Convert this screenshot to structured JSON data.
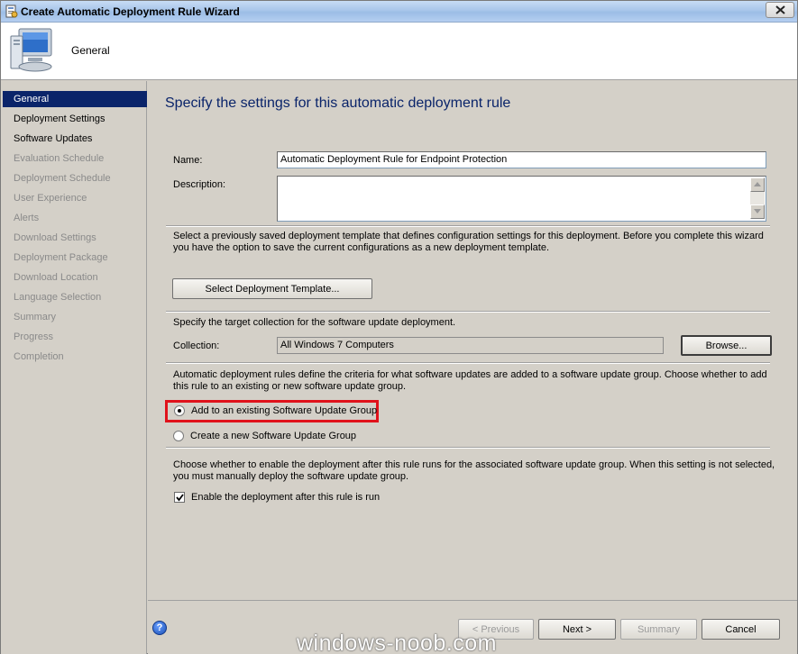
{
  "window": {
    "title": "Create Automatic Deployment Rule Wizard",
    "header_title": "General"
  },
  "sidebar": {
    "items": [
      {
        "label": "General",
        "state": "active"
      },
      {
        "label": "Deployment Settings",
        "state": "done"
      },
      {
        "label": "Software Updates",
        "state": "done"
      },
      {
        "label": "Evaluation Schedule",
        "state": "pending"
      },
      {
        "label": "Deployment Schedule",
        "state": "pending"
      },
      {
        "label": "User Experience",
        "state": "pending"
      },
      {
        "label": "Alerts",
        "state": "pending"
      },
      {
        "label": "Download Settings",
        "state": "pending"
      },
      {
        "label": "Deployment Package",
        "state": "pending"
      },
      {
        "label": "Download Location",
        "state": "pending"
      },
      {
        "label": "Language Selection",
        "state": "pending"
      },
      {
        "label": "Summary",
        "state": "pending"
      },
      {
        "label": "Progress",
        "state": "pending"
      },
      {
        "label": "Completion",
        "state": "pending"
      }
    ]
  },
  "main": {
    "heading": "Specify the settings for this automatic deployment rule",
    "name_label": "Name:",
    "name_value": "Automatic Deployment Rule for Endpoint Protection",
    "description_label": "Description:",
    "description_value": "",
    "template_text": "Select a previously saved deployment template that defines configuration settings for this deployment. Before you complete this wizard you have the option to save the current configurations as a new deployment template.",
    "template_button": "Select Deployment Template...",
    "collection_text": "Specify the target collection for the software update deployment.",
    "collection_label": "Collection:",
    "collection_value": "All Windows 7 Computers",
    "browse_button": "Browse...",
    "group_text": "Automatic deployment rules define the criteria for what software updates are added to a software update group. Choose whether to add this rule to an existing or new software update group.",
    "radio_existing": "Add to an existing Software Update Group",
    "radio_existing_checked": true,
    "radio_new": "Create a new Software Update Group",
    "radio_new_checked": false,
    "enable_text": "Choose whether to enable the deployment after this rule runs for the associated software update group. When this setting is not selected, you must manually deploy the software update group.",
    "enable_checkbox": "Enable the deployment after this rule is run",
    "enable_checked": true
  },
  "footer": {
    "previous": "< Previous",
    "next": "Next >",
    "summary": "Summary",
    "cancel": "Cancel",
    "watermark": "windows-noob.com"
  },
  "colors": {
    "active_step_bg": "#0a246a",
    "heading": "#0a246a",
    "highlight": "#e0121b"
  }
}
